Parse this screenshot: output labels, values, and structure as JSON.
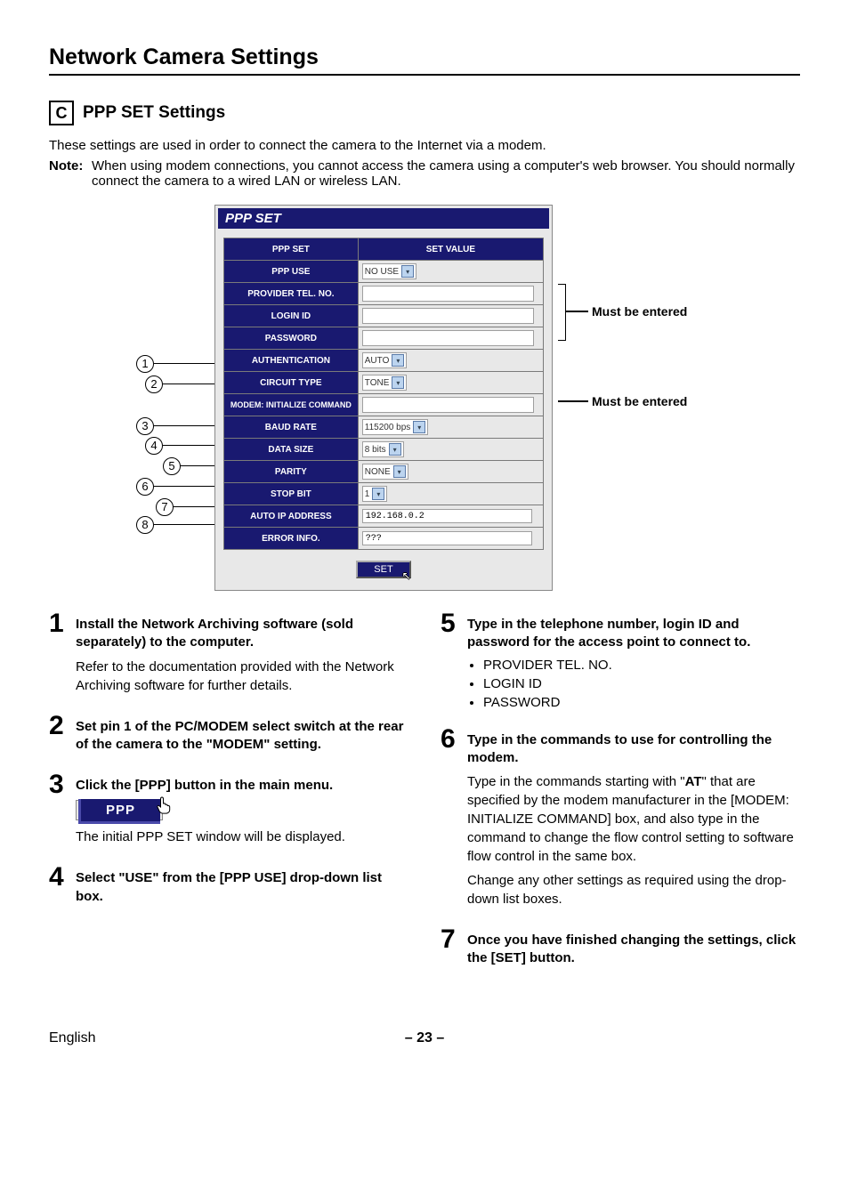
{
  "page_title": "Network Camera Settings",
  "section_letter": "C",
  "section_title": "PPP SET Settings",
  "intro": "These settings are used in order to connect the camera to the Internet via a modem.",
  "note_label": "Note:",
  "note_text": "When using modem connections, you cannot access the camera using a computer's web browser. You should normally connect the camera to a wired LAN or wireless LAN.",
  "panel": {
    "title": "PPP SET",
    "header_left": "PPP SET",
    "header_right": "SET VALUE",
    "rows": [
      {
        "label": "PPP USE",
        "type": "select",
        "value": "NO USE",
        "num": null
      },
      {
        "label": "PROVIDER TEL. NO.",
        "type": "input",
        "value": "",
        "num": null
      },
      {
        "label": "LOGIN ID",
        "type": "input",
        "value": "",
        "num": null
      },
      {
        "label": "PASSWORD",
        "type": "input",
        "value": "",
        "num": null
      },
      {
        "label": "AUTHENTICATION",
        "type": "select",
        "value": "AUTO",
        "num": "1"
      },
      {
        "label": "CIRCUIT TYPE",
        "type": "select",
        "value": "TONE",
        "num": "2"
      },
      {
        "label": "MODEM: INITIALIZE COMMAND",
        "type": "input",
        "value": "",
        "num": null
      },
      {
        "label": "BAUD RATE",
        "type": "select",
        "value": "115200 bps",
        "num": "3"
      },
      {
        "label": "DATA SIZE",
        "type": "select",
        "value": "8 bits",
        "num": "4"
      },
      {
        "label": "PARITY",
        "type": "select",
        "value": "NONE",
        "num": "5"
      },
      {
        "label": "STOP BIT",
        "type": "select",
        "value": "1",
        "num": "6"
      },
      {
        "label": "AUTO IP ADDRESS",
        "type": "text",
        "value": "192.168.0.2",
        "num": "7"
      },
      {
        "label": "ERROR INFO.",
        "type": "text",
        "value": "???",
        "num": "8"
      }
    ],
    "set_button": "SET"
  },
  "must_label": "Must be entered",
  "steps_left": [
    {
      "num": "1",
      "head": "Install the Network Archiving software (sold separately) to the computer.",
      "text": "Refer to the documentation provided with the Network Archiving software for further details."
    },
    {
      "num": "2",
      "head": "Set pin 1 of the PC/MODEM select switch at the rear of the camera to the \"MODEM\" setting."
    },
    {
      "num": "3",
      "head": "Click the [PPP] button in the main menu.",
      "ppp_btn": "PPP",
      "text": "The initial PPP SET window will be displayed."
    },
    {
      "num": "4",
      "head": "Select \"USE\" from the [PPP USE] drop-down list box."
    }
  ],
  "steps_right": [
    {
      "num": "5",
      "head": "Type in the telephone number, login ID and password for the access point to connect to.",
      "bullets": [
        "PROVIDER TEL. NO.",
        "LOGIN ID",
        "PASSWORD"
      ]
    },
    {
      "num": "6",
      "head": "Type in the commands to use for controlling the modem.",
      "text_parts": [
        "Type in the commands starting with \"",
        "AT",
        "\" that are specified by the modem manufacturer in the [MODEM: INITIALIZE COMMAND] box, and also type in the command to change the flow control setting to software flow control in the same box."
      ],
      "text2": "Change any other settings as required using the drop-down list boxes."
    },
    {
      "num": "7",
      "head": "Once you have finished changing the settings, click the [SET] button."
    }
  ],
  "footer": {
    "left": "English",
    "center": "– 23 –"
  }
}
